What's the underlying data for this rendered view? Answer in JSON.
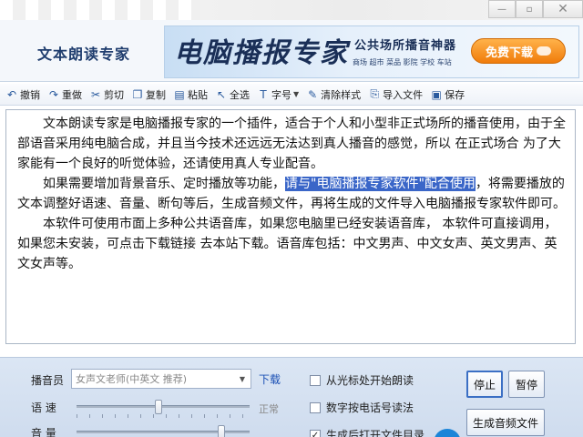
{
  "window": {
    "minimize_glyph": "—",
    "restore_glyph": "▫",
    "close_glyph": "✕"
  },
  "banner": {
    "app_title": "文本朗读专家",
    "ad_title": "电脑播报专家",
    "ad_subtitle": "公共场所播音神器",
    "ad_tags": "商场 超市 菜品 影院 学校 车站",
    "ad_button": "免费下载"
  },
  "toolbar": {
    "items": [
      {
        "label": "撤销",
        "icon": "undo-icon",
        "glyph": "↶"
      },
      {
        "label": "重做",
        "icon": "redo-icon",
        "glyph": "↷"
      },
      {
        "label": "剪切",
        "icon": "scissors-icon",
        "glyph": "✂"
      },
      {
        "label": "复制",
        "icon": "copy-icon",
        "glyph": "❐"
      },
      {
        "label": "粘贴",
        "icon": "paste-icon",
        "glyph": "▤"
      },
      {
        "label": "全选",
        "icon": "cursor-icon",
        "glyph": "↖"
      },
      {
        "label": "字号",
        "icon": "font-size-icon",
        "glyph": "T"
      },
      {
        "label": "清除样式",
        "icon": "brush-icon",
        "glyph": "✎"
      },
      {
        "label": "导入文件",
        "icon": "import-icon",
        "glyph": "⎘"
      },
      {
        "label": "保存",
        "icon": "save-icon",
        "glyph": "▣"
      }
    ]
  },
  "editor": {
    "p1": "文本朗读专家是电脑播报专家的一个插件，适合于个人和小型非正式场所的播音使用，由于全部语音采用纯电脑合成，并且当今技术还远远无法达到真人播音的感觉，所以 在正式场合 为了大家能有一个良好的听觉体验，还请使用真人专业配音。",
    "p2_before": "如果需要增加背景音乐、定时播放等功能，",
    "p2_selected": "请与\"电脑播报专家软件\"配合使用",
    "p2_after": "，将需要播放的文本调整好语速、音量、断句等后，生成音频文件，再将生成的文件导入电脑播报专家软件即可。",
    "p3": "本软件可使用市面上多种公共语音库，如果您电脑里已经安装语音库，  本软件可直接调用，如果您未安装，可点击下载链接 去本站下载。语音库包括：中文男声、中文女声、英文男声、英文女声等。"
  },
  "controls": {
    "voice_label": "播音员",
    "voice_value": "女声文老师(中英文 推荐)",
    "download_link": "下载",
    "speed_label": "语  速",
    "speed_hint": "正常",
    "speed_value": 0.47,
    "volume_label": "音  量",
    "volume_value": 0.85,
    "checkboxes": [
      {
        "label": "从光标处开始朗读",
        "checked": false
      },
      {
        "label": "数字按电话号读法",
        "checked": false
      },
      {
        "label": "生成后打开文件目录",
        "checked": true
      }
    ],
    "stop_button": "停止",
    "pause_button": "暂停",
    "generate_button": "生成音频文件"
  },
  "colors": {
    "accent": "#3a66c8",
    "ad_button": "#f07c0b",
    "link": "#1a4fb4"
  }
}
